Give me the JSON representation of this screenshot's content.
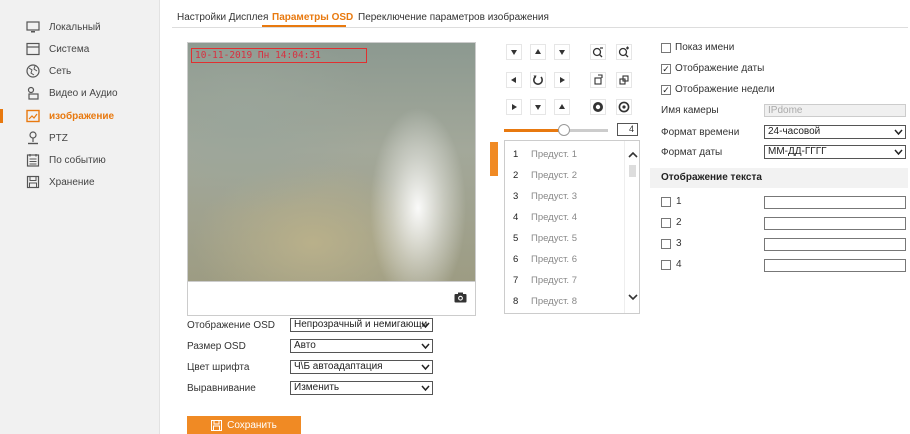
{
  "sidebar": {
    "items": [
      {
        "label": "Локальный",
        "icon": "monitor-icon"
      },
      {
        "label": "Система",
        "icon": "system-icon"
      },
      {
        "label": "Сеть",
        "icon": "globe-icon"
      },
      {
        "label": "Видео и Аудио",
        "icon": "video-audio-icon"
      },
      {
        "label": "изображение",
        "icon": "image-icon",
        "active": true
      },
      {
        "label": "PTZ",
        "icon": "ptz-icon"
      },
      {
        "label": "По событию",
        "icon": "calendar-icon"
      },
      {
        "label": "Хранение",
        "icon": "storage-icon"
      }
    ]
  },
  "tabs": [
    {
      "label": "Настройки Дисплея"
    },
    {
      "label": "Параметры OSD",
      "active": true
    },
    {
      "label": "Переключение параметров изображения"
    }
  ],
  "video": {
    "osd_text": "10-11-2019 Пн 14:04:31"
  },
  "osd_form": {
    "display_label": "Отображение OSD",
    "display_value": "Непрозрачный и немигающи",
    "size_label": "Размер OSD",
    "size_value": "Авто",
    "color_label": "Цвет шрифта",
    "color_value": "Ч\\Б автоадаптация",
    "align_label": "Выравнивание",
    "align_value": "Изменить"
  },
  "save_label": "Сохранить",
  "ptz": {
    "zoom_value": "4",
    "presets": [
      {
        "num": "1",
        "name": "Предуст. 1"
      },
      {
        "num": "2",
        "name": "Предуст. 2"
      },
      {
        "num": "3",
        "name": "Предуст. 3"
      },
      {
        "num": "4",
        "name": "Предуст. 4"
      },
      {
        "num": "5",
        "name": "Предуст. 5"
      },
      {
        "num": "6",
        "name": "Предуст. 6"
      },
      {
        "num": "7",
        "name": "Предуст. 7"
      },
      {
        "num": "8",
        "name": "Предуст. 8"
      }
    ]
  },
  "right": {
    "show_name_label": "Показ имени",
    "show_name_checked": false,
    "show_date_label": "Отображение даты",
    "show_date_checked": true,
    "show_week_label": "Отображение недели",
    "show_week_checked": true,
    "camera_name_label": "Имя камеры",
    "camera_name_value": "IPdome",
    "time_format_label": "Формат времени",
    "time_format_value": "24-часовой",
    "date_format_label": "Формат даты",
    "date_format_value": "ММ-ДД-ГГГГ",
    "text_section_title": "Отображение текста",
    "text_rows": [
      {
        "num": "1",
        "value": "",
        "checked": false
      },
      {
        "num": "2",
        "value": "",
        "checked": false
      },
      {
        "num": "3",
        "value": "",
        "checked": false
      },
      {
        "num": "4",
        "value": "",
        "checked": false
      }
    ]
  },
  "colors": {
    "accent": "#e8790f",
    "button": "#f08a24"
  }
}
